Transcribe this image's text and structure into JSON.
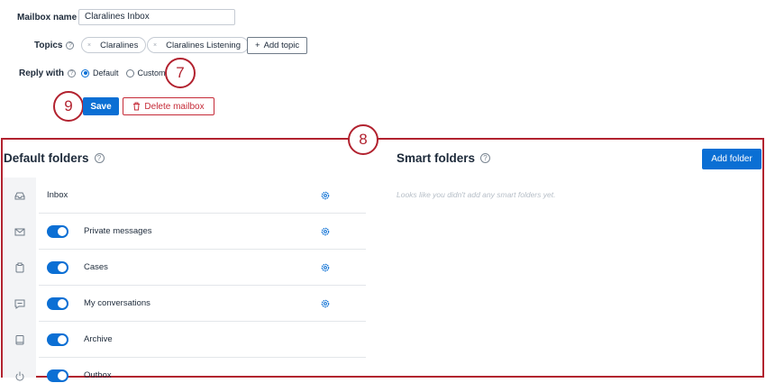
{
  "form": {
    "mailbox_name_label": "Mailbox name",
    "mailbox_name_value": "Claralines Inbox",
    "topics_label": "Topics",
    "topics": [
      "Claralines",
      "Claralines Listening"
    ],
    "add_topic_label": "Add topic",
    "reply_with_label": "Reply with",
    "reply_options": [
      "Default",
      "Custom"
    ],
    "reply_selected": "Default",
    "save_label": "Save",
    "delete_label": "Delete mailbox"
  },
  "annotations": [
    "7",
    "8",
    "9"
  ],
  "default_folders": {
    "title": "Default folders",
    "items": [
      {
        "label": "Inbox",
        "icon": "inbox-icon",
        "toggle": false,
        "settings": true
      },
      {
        "label": "Private messages",
        "icon": "envelope-icon",
        "toggle": true,
        "settings": true
      },
      {
        "label": "Cases",
        "icon": "clipboard-icon",
        "toggle": true,
        "settings": true
      },
      {
        "label": "My conversations",
        "icon": "chat-icon",
        "toggle": true,
        "settings": true
      },
      {
        "label": "Archive",
        "icon": "book-icon",
        "toggle": true,
        "settings": false
      },
      {
        "label": "Outbox",
        "icon": "power-icon",
        "toggle": true,
        "settings": false
      }
    ]
  },
  "smart_folders": {
    "title": "Smart folders",
    "add_label": "Add folder",
    "empty_message": "Looks like you didn't add any smart folders yet."
  },
  "colors": {
    "accent": "#0b6fd4",
    "annotation": "#b2222f",
    "danger": "#c52a37"
  }
}
